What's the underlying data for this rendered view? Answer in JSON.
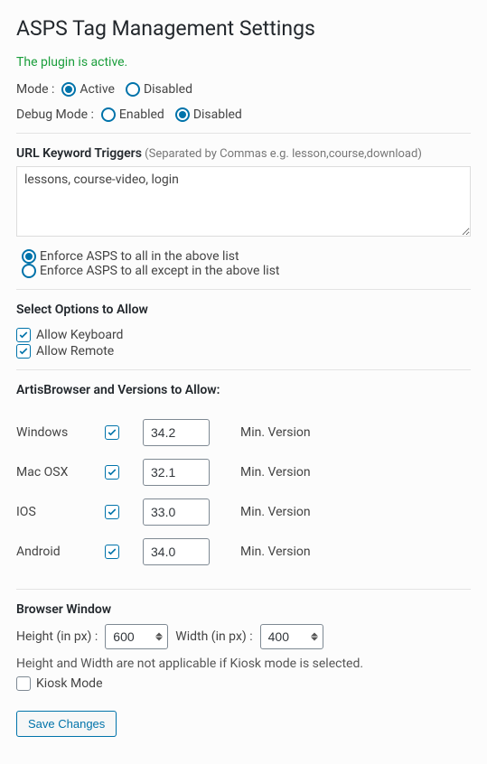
{
  "title": "ASPS Tag Management Settings",
  "status": "The plugin is active.",
  "mode": {
    "label": "Mode :",
    "options": {
      "active": "Active",
      "disabled": "Disabled"
    },
    "value": "active"
  },
  "debug": {
    "label": "Debug Mode :",
    "options": {
      "enabled": "Enabled",
      "disabled": "Disabled"
    },
    "value": "disabled"
  },
  "url_triggers": {
    "title": "URL Keyword Triggers",
    "hint": "(Separated by Commas e.g. lesson,course,download)",
    "value": "lessons, course-video, login"
  },
  "enforce": {
    "all_label": "Enforce ASPS to all in the above list",
    "except_label": "Enforce ASPS to all except in the above list",
    "value": "all"
  },
  "allow_options": {
    "title": "Select Options to Allow",
    "keyboard": {
      "label": "Allow Keyboard",
      "checked": true
    },
    "remote": {
      "label": "Allow Remote",
      "checked": true
    }
  },
  "artis": {
    "title": "ArtisBrowser and Versions to Allow:",
    "min_label": "Min. Version",
    "rows": [
      {
        "os": "Windows",
        "checked": true,
        "version": "34.2"
      },
      {
        "os": "Mac OSX",
        "checked": true,
        "version": "32.1"
      },
      {
        "os": "IOS",
        "checked": true,
        "version": "33.0"
      },
      {
        "os": "Android",
        "checked": true,
        "version": "34.0"
      }
    ]
  },
  "browser_window": {
    "title": "Browser Window",
    "height_label": "Height (in px) :",
    "height": "600",
    "width_label": "Width (in px) :",
    "width": "400",
    "note": "Height and Width are not applicable if Kiosk mode is selected.",
    "kiosk": {
      "label": "Kiosk Mode",
      "checked": false
    }
  },
  "save_label": "Save Changes"
}
